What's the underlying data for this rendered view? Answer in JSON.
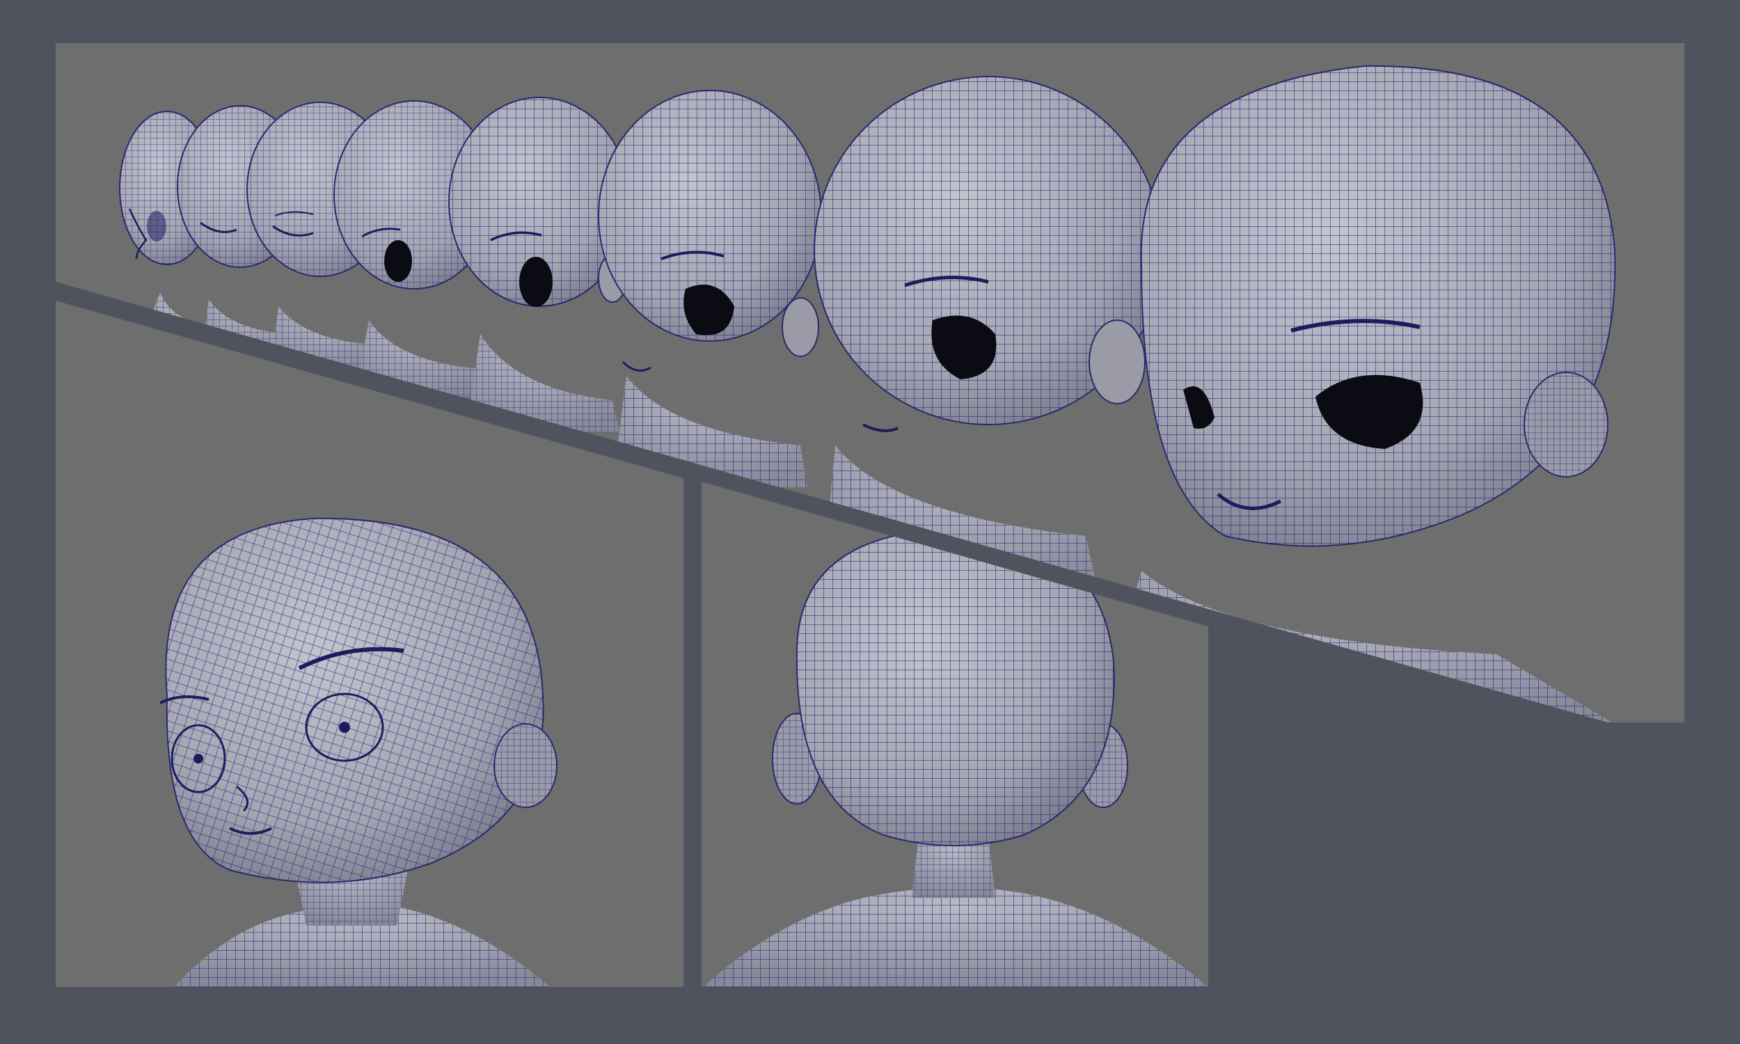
{
  "sheet": {
    "background_color": "#4f535e",
    "viewport_color": "#6e6e6e",
    "mesh_base_color": "#a9aab3",
    "wire_color": "#1f1f8a",
    "eye_socket_color": "#0b0b14"
  },
  "panels": [
    {
      "name": "side-profile-lineup-panel",
      "subject": "eight-head-side-lineup"
    },
    {
      "name": "front-three-quarter-panel",
      "subject": "head-front-three-quarter"
    },
    {
      "name": "back-view-panel",
      "subject": "head-back-view"
    }
  ]
}
